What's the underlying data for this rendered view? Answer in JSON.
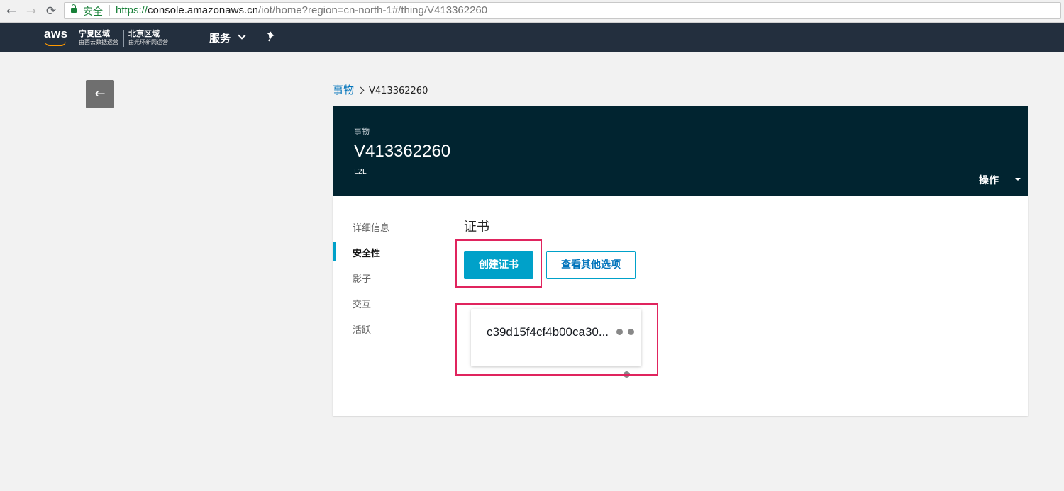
{
  "browser": {
    "back_icon": "←",
    "forward_icon": "→",
    "reload_icon": "⟳",
    "secure_label": "安全",
    "url_scheme": "https://",
    "url_host": "console.amazonaws.cn",
    "url_path": "/iot/home?region=cn-north-1#/thing/V413362260"
  },
  "aws_nav": {
    "logo_text": "aws",
    "regions": [
      {
        "name": "宁夏区域",
        "sub": "由西云数据运营"
      },
      {
        "name": "北京区域",
        "sub": "由光环新网运营"
      }
    ],
    "services_label": "服务"
  },
  "page": {
    "back_icon": "←",
    "breadcrumb": {
      "link": "事物",
      "current": "V413362260"
    },
    "header": {
      "type_label": "事物",
      "name": "V413362260",
      "subtype": "L2L",
      "actions_label": "操作"
    },
    "side_nav": [
      {
        "label": "详细信息",
        "active": false
      },
      {
        "label": "安全性",
        "active": true
      },
      {
        "label": "影子",
        "active": false
      },
      {
        "label": "交互",
        "active": false
      },
      {
        "label": "活跃",
        "active": false
      }
    ],
    "section_title": "证书",
    "create_cert_label": "创建证书",
    "more_options_label": "查看其他选项",
    "certificate_id": "c39d15f4cf4b00ca30..."
  },
  "colors": {
    "nav_bg": "#232f3e",
    "header_bg": "#012430",
    "accent": "#00a1c9",
    "highlight": "#e0245e"
  }
}
